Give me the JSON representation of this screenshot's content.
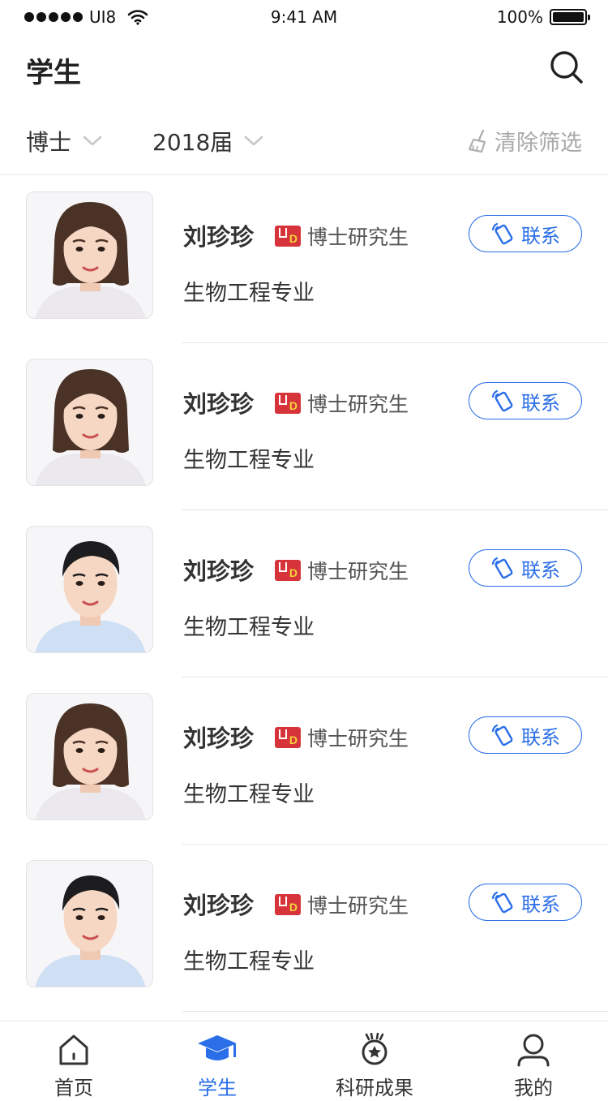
{
  "status_bar": {
    "carrier": "UI8",
    "time": "9:41 AM",
    "battery": "100%"
  },
  "header": {
    "title": "学生"
  },
  "filters": {
    "degree": "博士",
    "year": "2018届",
    "clear": "清除筛选"
  },
  "students": [
    {
      "name": "刘珍珍",
      "degree": "博士研究生",
      "major": "生物工程专业",
      "contact": "联系",
      "avatar": "female-portrait"
    },
    {
      "name": "刘珍珍",
      "degree": "博士研究生",
      "major": "生物工程专业",
      "contact": "联系",
      "avatar": "female-portrait"
    },
    {
      "name": "刘珍珍",
      "degree": "博士研究生",
      "major": "生物工程专业",
      "contact": "联系",
      "avatar": "male-portrait"
    },
    {
      "name": "刘珍珍",
      "degree": "博士研究生",
      "major": "生物工程专业",
      "contact": "联系",
      "avatar": "female-portrait"
    },
    {
      "name": "刘珍珍",
      "degree": "博士研究生",
      "major": "生物工程专业",
      "contact": "联系",
      "avatar": "male-portrait"
    }
  ],
  "tabs": [
    {
      "label": "首页",
      "icon": "home-icon"
    },
    {
      "label": "学生",
      "icon": "graduation-cap-icon"
    },
    {
      "label": "科研成果",
      "icon": "medal-icon"
    },
    {
      "label": "我的",
      "icon": "user-icon"
    }
  ],
  "colors": {
    "accent": "#2a6ee8",
    "badge": "#d6343a",
    "muted": "#a8a8a8"
  }
}
